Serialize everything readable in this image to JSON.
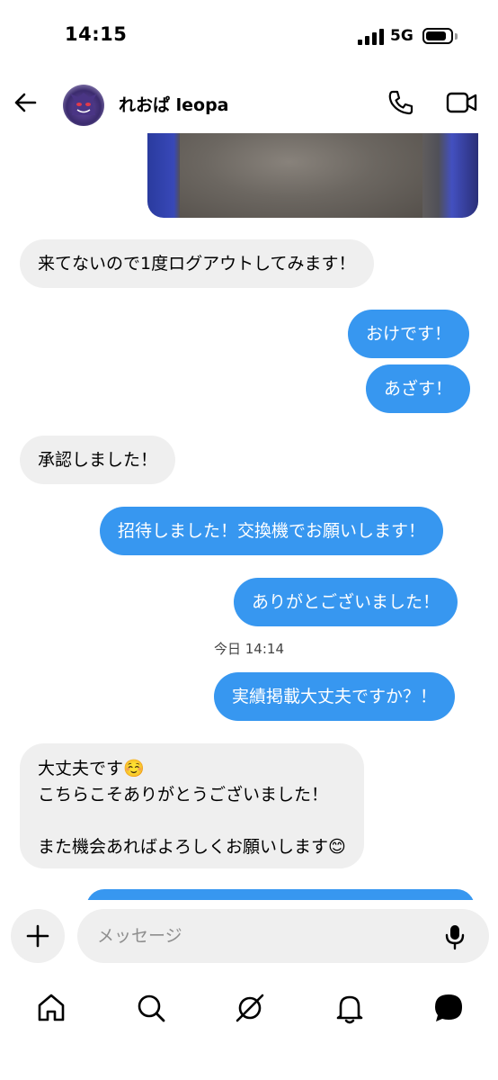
{
  "status": {
    "time": "14:15",
    "network": "5G"
  },
  "header": {
    "contact_name": "れおぱ leopa"
  },
  "messages": [
    {
      "dir": "in",
      "text": "来てないので1度ログアウトしてみます！"
    },
    {
      "dir": "out",
      "text": "おけです！"
    },
    {
      "dir": "out",
      "text": "あざす！"
    },
    {
      "dir": "in",
      "text": "承認しました！"
    },
    {
      "dir": "out",
      "text": "招待しました！交換機でお願いします！"
    },
    {
      "dir": "out",
      "text": "ありがとございました！"
    },
    {
      "dir": "out",
      "text": "実績掲載大丈夫ですか？！"
    },
    {
      "dir": "in",
      "text": "大丈夫です☺️\nこちらこそありがとうございました！\n\nまた機会あればよろしくお願いします😊"
    }
  ],
  "timestamp": "今日 14:14",
  "composer": {
    "placeholder": "メッセージ"
  },
  "colors": {
    "outgoing_bubble": "#3797f0",
    "incoming_bubble": "#efefef"
  },
  "icons": {
    "header": [
      "back-arrow-icon",
      "phone-icon",
      "video-camera-icon"
    ],
    "composer": [
      "plus-icon",
      "microphone-icon"
    ],
    "nav": [
      "home-icon",
      "search-icon",
      "explore-icon",
      "notifications-icon",
      "messages-icon"
    ]
  }
}
